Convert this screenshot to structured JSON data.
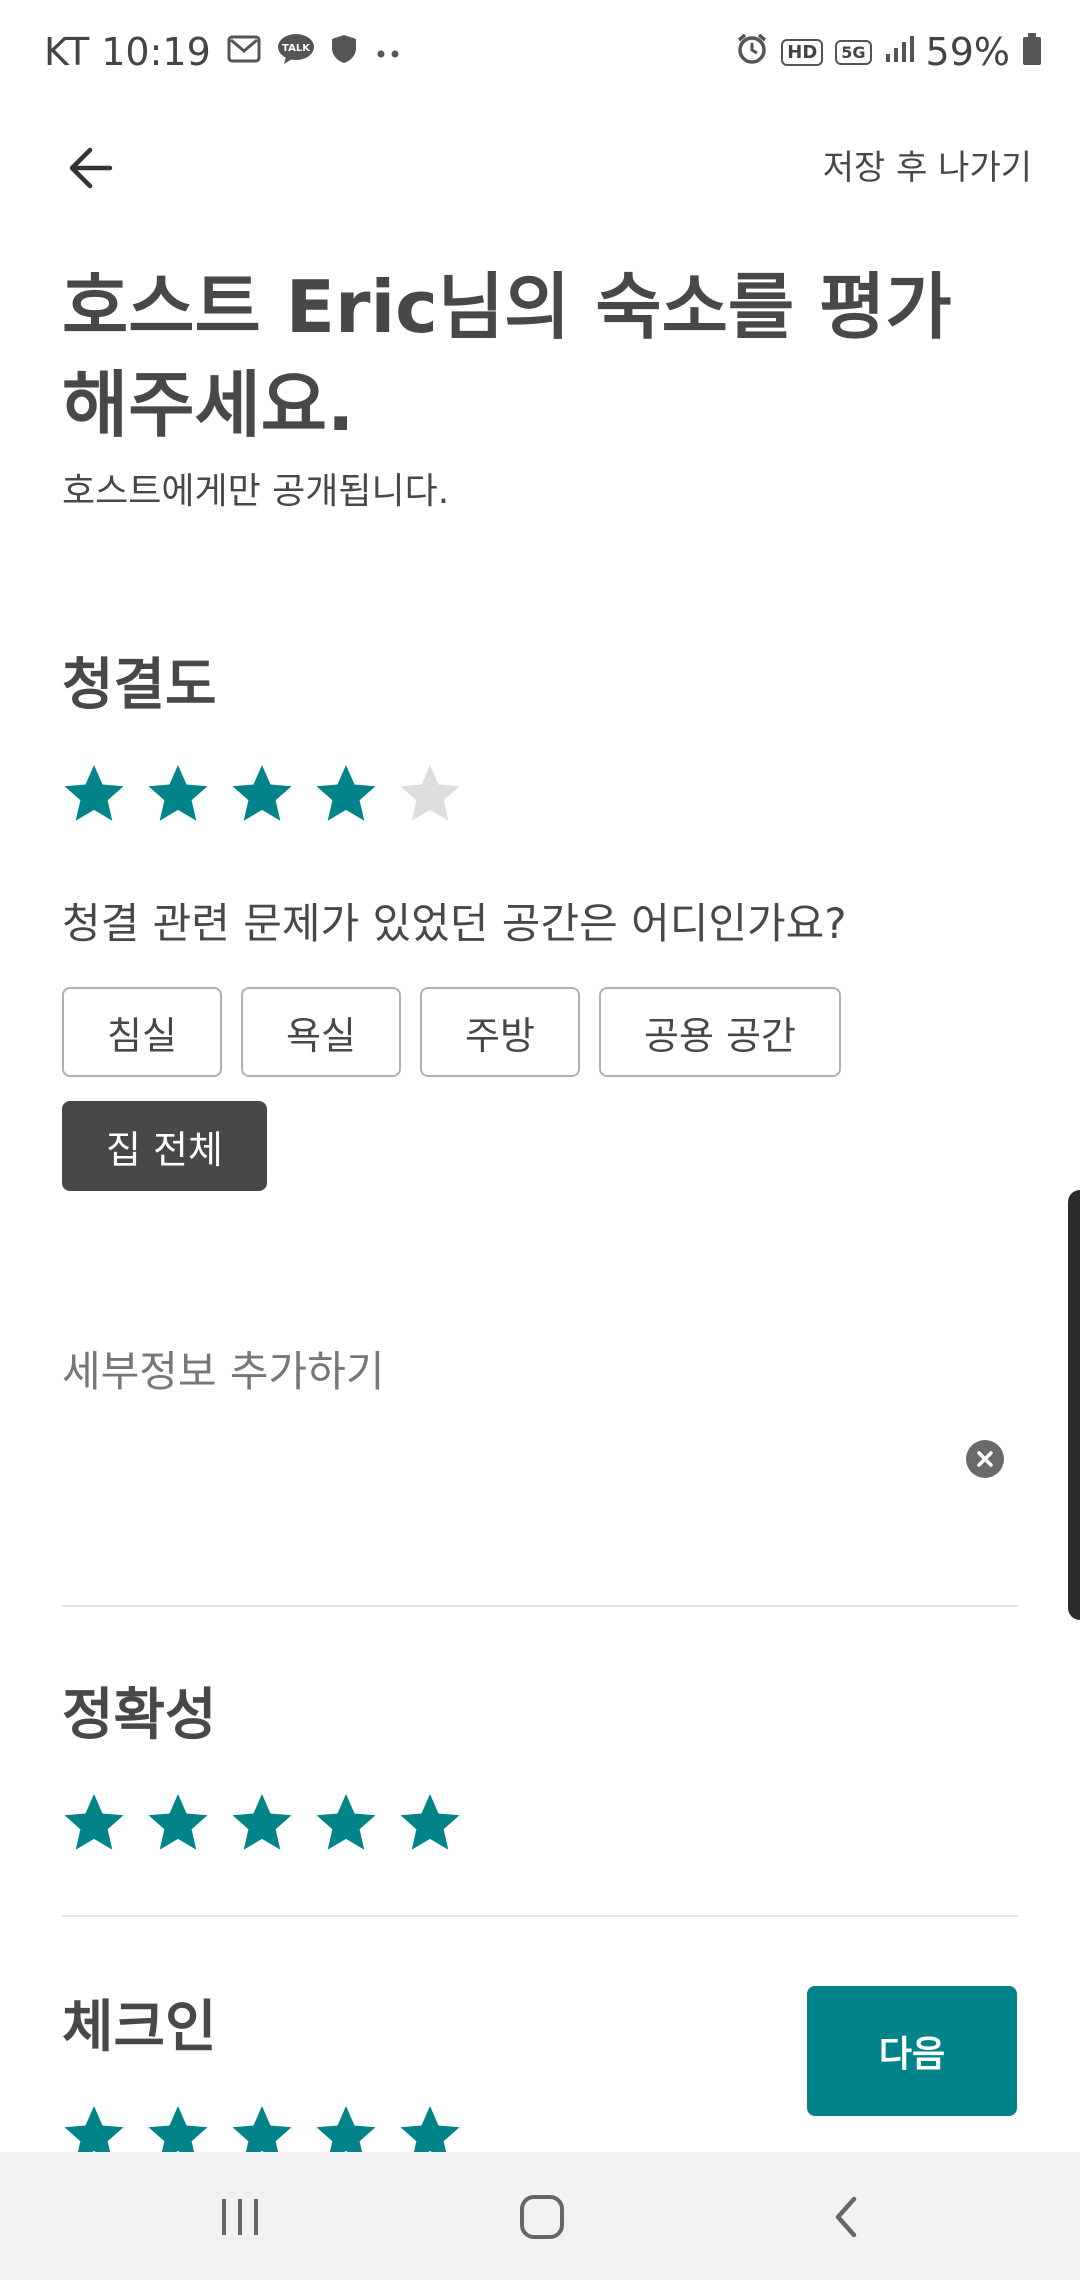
{
  "status_bar": {
    "carrier_time": "KT 10:19",
    "talk_badge": "TALK",
    "hd_badge": "HD",
    "network": "5G",
    "battery": "59%",
    "icons": [
      "gmail-icon",
      "kakaotalk-icon",
      "shield-icon",
      "more-dots-icon",
      "alarm-icon",
      "hd-icon",
      "5g-icon",
      "signal-icon",
      "battery-icon"
    ]
  },
  "header": {
    "save_exit_label": "저장 후 나가기",
    "back_icon": "arrow-left-icon"
  },
  "page": {
    "title": "호스트 Eric님의 숙소를 평가해주세요.",
    "subtitle": "호스트에게만 공개됩니다."
  },
  "colors": {
    "accent": "#008489",
    "star_empty": "#dddddd",
    "chip_selected": "#484848",
    "text": "#484848"
  },
  "sections": {
    "cleanliness": {
      "title": "청결도",
      "rating": 4,
      "max": 5,
      "question": "청결 관련 문제가 있었던 공간은 어디인가요?",
      "chips": [
        {
          "label": "침실",
          "selected": false
        },
        {
          "label": "욕실",
          "selected": false
        },
        {
          "label": "주방",
          "selected": false
        },
        {
          "label": "공용 공간",
          "selected": false
        },
        {
          "label": "집 전체",
          "selected": true
        }
      ],
      "detail_placeholder": "세부정보 추가하기"
    },
    "accuracy": {
      "title": "정확성",
      "rating": 5,
      "max": 5
    },
    "checkin": {
      "title": "체크인",
      "rating": 5,
      "max": 5
    }
  },
  "footer": {
    "next_label": "다음"
  }
}
